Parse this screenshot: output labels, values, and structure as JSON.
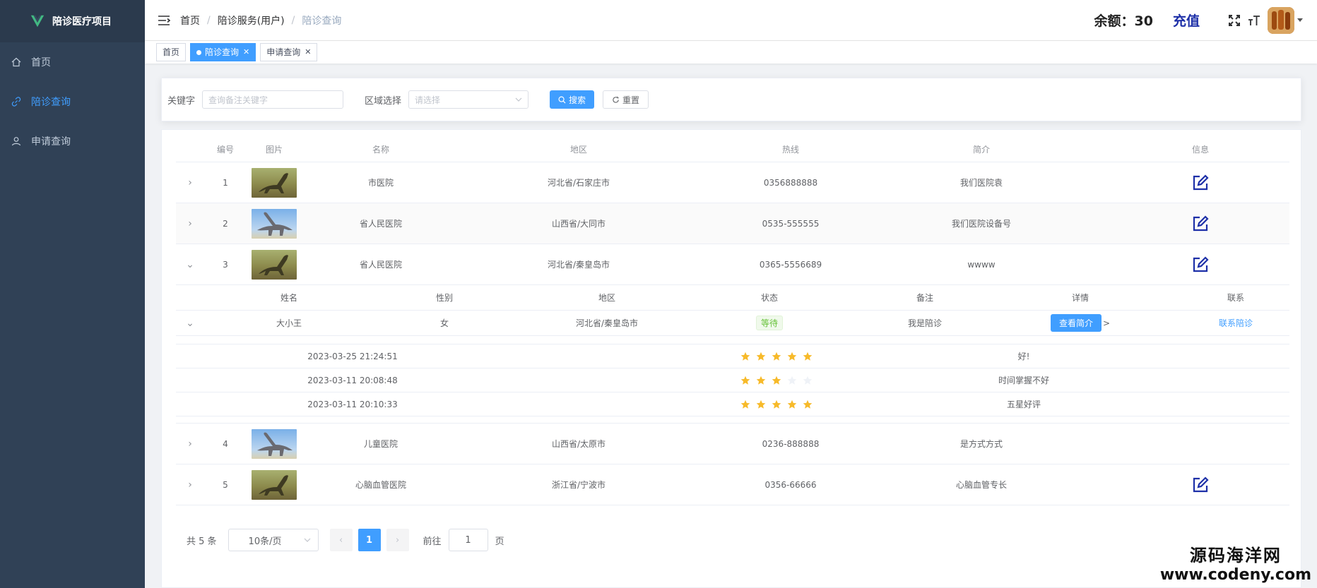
{
  "app": {
    "title": "陪诊医疗项目"
  },
  "sidebar": {
    "items": [
      {
        "label": "首页",
        "icon": "home-icon"
      },
      {
        "label": "陪诊查询",
        "icon": "link-icon"
      },
      {
        "label": "申请查询",
        "icon": "user-icon"
      }
    ]
  },
  "header": {
    "breadcrumb": [
      "首页",
      "陪诊服务(用户)",
      "陪诊查询"
    ],
    "balance": "余额：30",
    "recharge": "充值"
  },
  "tags": [
    {
      "label": "首页"
    },
    {
      "label": "陪诊查询"
    },
    {
      "label": "申请查询"
    }
  ],
  "search": {
    "keyword_label": "关键字",
    "keyword_placeholder": "查询备注关键字",
    "region_label": "区域选择",
    "region_placeholder": "请选择",
    "search_button": "搜索",
    "reset_button": "重置"
  },
  "table": {
    "headers": [
      "编号",
      "图片",
      "名称",
      "地区",
      "热线",
      "简介",
      "信息"
    ],
    "rows": [
      {
        "id": "1",
        "name": "市医院",
        "region": "河北省/石家庄市",
        "hotline": "0356888888",
        "intro": "我们医院袁",
        "expand": "›"
      },
      {
        "id": "2",
        "name": "省人民医院",
        "region": "山西省/大同市",
        "hotline": "0535-555555",
        "intro": "我们医院设备号",
        "expand": "›"
      },
      {
        "id": "3",
        "name": "省人民医院",
        "region": "河北省/秦皇岛市",
        "hotline": "0365-5556689",
        "intro": "wwww",
        "expand": "⌄"
      },
      {
        "id": "4",
        "name": "儿童医院",
        "region": "山西省/太原市",
        "hotline": "0236-888888",
        "intro": "是方式方式",
        "expand": "›"
      },
      {
        "id": "5",
        "name": "心脑血管医院",
        "region": "浙江省/宁波市",
        "hotline": "0356-66666",
        "intro": "心脑血管专长",
        "expand": "›"
      }
    ],
    "sub": {
      "headers": [
        "姓名",
        "性别",
        "地区",
        "状态",
        "备注",
        "详情",
        "联系"
      ],
      "row": {
        "name": "大小王",
        "gender": "女",
        "region": "河北省/秦皇岛市",
        "status": "等待",
        "remark": "我是陪诊",
        "detail_button": "查看简介",
        "detail_suffix": ">",
        "contact": "联系陪诊"
      },
      "reviews": [
        {
          "time": "2023-03-25 21:24:51",
          "rating": 5,
          "comment": "好!"
        },
        {
          "time": "2023-03-11 20:08:48",
          "rating": 3,
          "comment": "时间掌握不好"
        },
        {
          "time": "2023-03-11 20:10:33",
          "rating": 5,
          "comment": "五星好评"
        }
      ]
    }
  },
  "pagination": {
    "total": "共 5 条",
    "page_size": "10条/页",
    "current_page": "1",
    "goto_label": "前往",
    "goto_value": "1",
    "page_suffix": "页",
    "prev": "‹",
    "next": "›"
  },
  "watermark": {
    "line1": "源码海洋网",
    "line2": "www.codeny.com"
  },
  "colors": {
    "primary": "#409eff",
    "sidebar": "#304156",
    "star": "#f7ba2a",
    "recharge": "#1e30a8"
  }
}
